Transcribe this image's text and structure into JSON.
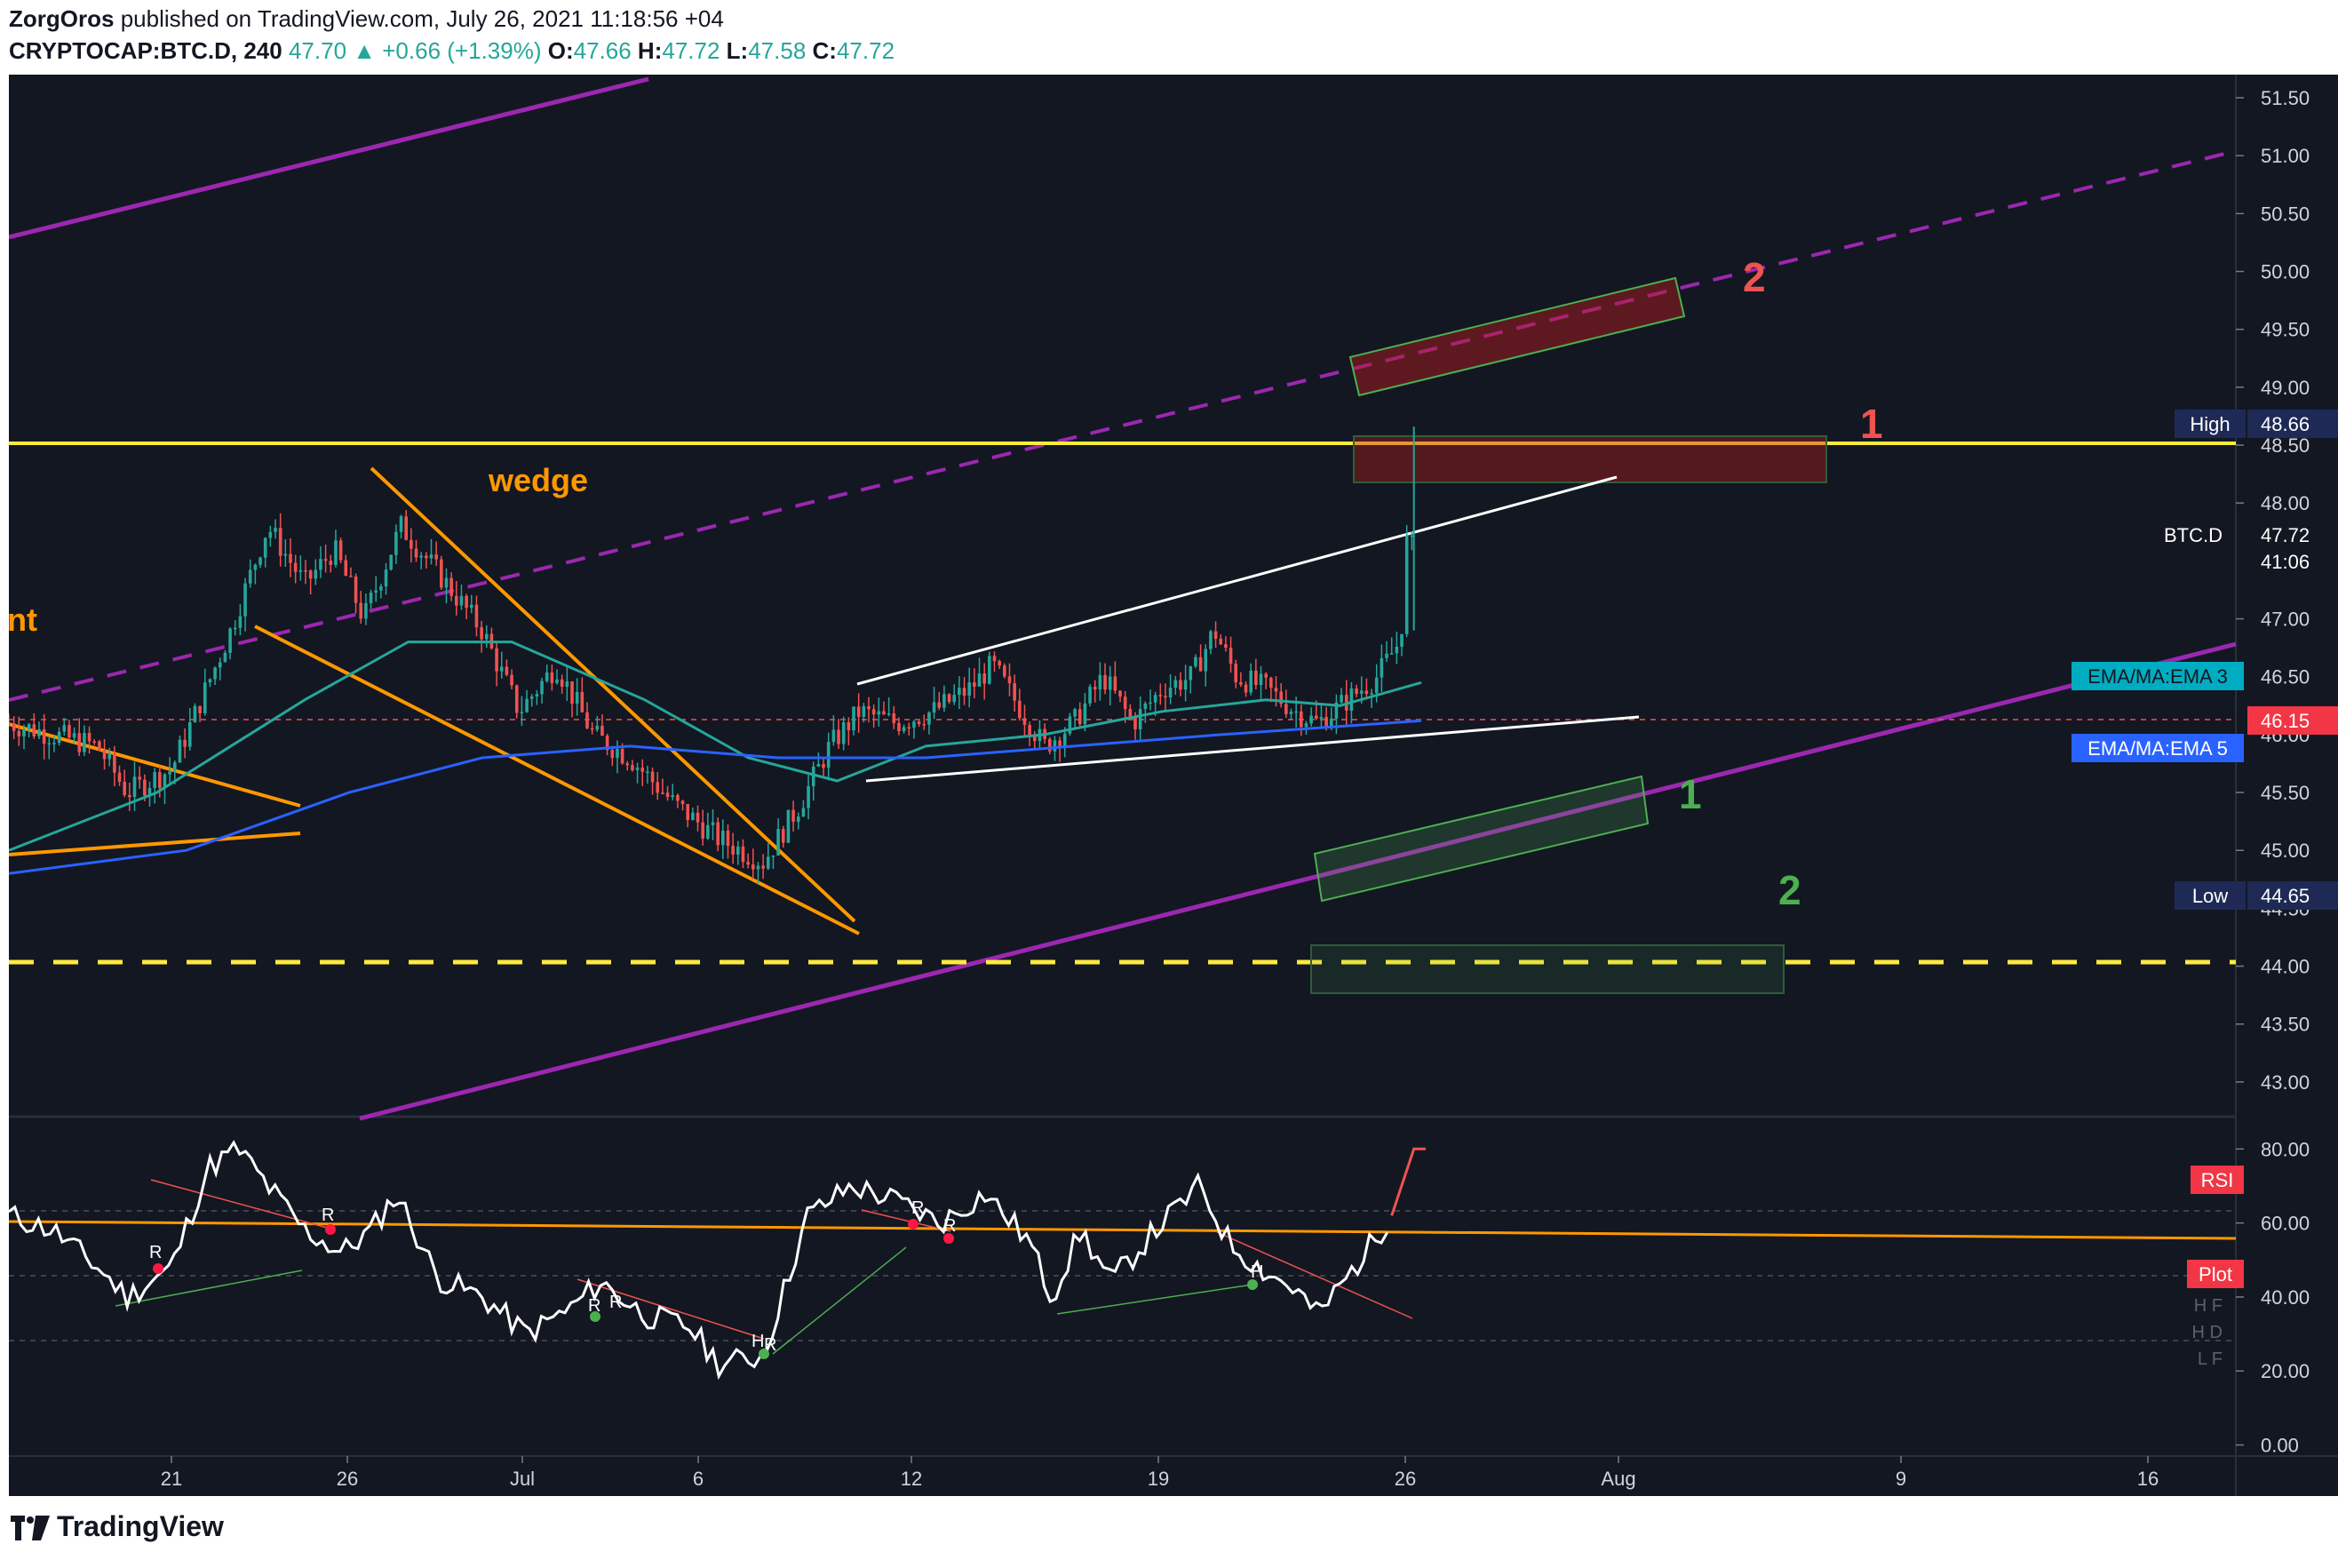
{
  "header": {
    "author": "ZorgOros",
    "published": "published on TradingView.com, July 26, 2021 11:18:56 +04",
    "symbol": "CRYPTOCAP:BTC.D, 240",
    "last": "47.70",
    "arrow": "▲",
    "change": "+0.66 (+1.39%)",
    "o_label": "O:",
    "o": "47.66",
    "h_label": "H:",
    "h": "47.72",
    "l_label": "L:",
    "l": "47.58",
    "c_label": "C:",
    "c": "47.72"
  },
  "annotations": {
    "wedge": "wedge",
    "edge_fragment": "nt",
    "red1": "1",
    "red2": "2",
    "green1": "1",
    "green2": "2"
  },
  "price_labels": {
    "high_title": "High",
    "high_value": "48.66",
    "btcd_title": "BTC.D",
    "btcd_value": "47.72",
    "btcd_countdown": "41:06",
    "ema3": "EMA/MA:EMA 3",
    "redline_value": "46.15",
    "ema5": "EMA/MA:EMA 5",
    "low_title": "Low",
    "low_value": "44.65",
    "rsi_title": "RSI",
    "plot_title": "Plot",
    "hf": "H F",
    "hd": "H D",
    "lf": "L F"
  },
  "footer": {
    "brand": "TradingView"
  },
  "colors": {
    "bg": "#131722",
    "up": "#26a69a",
    "down": "#ef5350",
    "yellow": "#ffeb3b",
    "purple": "#9c27b0",
    "orange": "#ff9800",
    "ema3": "#26a69a",
    "ema5": "#2962ff"
  },
  "chart_data": {
    "type": "candlestick",
    "title": "",
    "price_axis": {
      "ticks": [
        "51.50",
        "51.00",
        "50.50",
        "50.00",
        "49.50",
        "49.00",
        "48.50",
        "48.00",
        "47.00",
        "46.50",
        "46.00",
        "45.50",
        "45.00",
        "44.50",
        "44.00",
        "43.50",
        "43.00"
      ],
      "ylim": [
        42.7,
        51.7
      ]
    },
    "rsi_axis": {
      "ticks": [
        "80.00",
        "60.00",
        "40.00",
        "20.00",
        "0.00"
      ],
      "ylim": [
        -3,
        88
      ]
    },
    "time_axis": {
      "labels": [
        "21",
        "26",
        "Jul",
        "6",
        "12",
        "19",
        "26",
        "Aug",
        "9",
        "16"
      ]
    },
    "close_path": [
      {
        "t": 0,
        "v": 46.1
      },
      {
        "t": 30,
        "v": 46.0
      },
      {
        "t": 60,
        "v": 45.9
      },
      {
        "t": 80,
        "v": 45.5
      },
      {
        "t": 110,
        "v": 45.7
      },
      {
        "t": 150,
        "v": 46.9
      },
      {
        "t": 175,
        "v": 47.8
      },
      {
        "t": 200,
        "v": 47.3
      },
      {
        "t": 220,
        "v": 47.6
      },
      {
        "t": 240,
        "v": 47.0
      },
      {
        "t": 265,
        "v": 47.8
      },
      {
        "t": 290,
        "v": 47.4
      },
      {
        "t": 320,
        "v": 46.9
      },
      {
        "t": 345,
        "v": 46.2
      },
      {
        "t": 370,
        "v": 46.6
      },
      {
        "t": 395,
        "v": 46.0
      },
      {
        "t": 420,
        "v": 45.8
      },
      {
        "t": 450,
        "v": 45.4
      },
      {
        "t": 480,
        "v": 45.1
      },
      {
        "t": 510,
        "v": 44.9
      },
      {
        "t": 535,
        "v": 45.4
      },
      {
        "t": 555,
        "v": 45.9
      },
      {
        "t": 575,
        "v": 46.2
      },
      {
        "t": 600,
        "v": 46.1
      },
      {
        "t": 625,
        "v": 46.2
      },
      {
        "t": 650,
        "v": 46.4
      },
      {
        "t": 665,
        "v": 46.6
      },
      {
        "t": 680,
        "v": 46.3
      },
      {
        "t": 700,
        "v": 45.9
      },
      {
        "t": 720,
        "v": 46.1
      },
      {
        "t": 740,
        "v": 46.5
      },
      {
        "t": 760,
        "v": 46.1
      },
      {
        "t": 780,
        "v": 46.4
      },
      {
        "t": 800,
        "v": 46.5
      },
      {
        "t": 815,
        "v": 46.9
      },
      {
        "t": 830,
        "v": 46.5
      },
      {
        "t": 850,
        "v": 46.4
      },
      {
        "t": 870,
        "v": 46.2
      },
      {
        "t": 885,
        "v": 46.1
      },
      {
        "t": 905,
        "v": 46.3
      },
      {
        "t": 925,
        "v": 46.5
      },
      {
        "t": 940,
        "v": 46.8
      },
      {
        "t": 950,
        "v": 47.7
      }
    ],
    "ema3": [
      {
        "t": 0,
        "v": 45.0
      },
      {
        "t": 100,
        "v": 45.5
      },
      {
        "t": 200,
        "v": 46.3
      },
      {
        "t": 270,
        "v": 46.8
      },
      {
        "t": 340,
        "v": 46.8
      },
      {
        "t": 430,
        "v": 46.3
      },
      {
        "t": 500,
        "v": 45.8
      },
      {
        "t": 560,
        "v": 45.6
      },
      {
        "t": 620,
        "v": 45.9
      },
      {
        "t": 700,
        "v": 46.0
      },
      {
        "t": 780,
        "v": 46.2
      },
      {
        "t": 850,
        "v": 46.3
      },
      {
        "t": 900,
        "v": 46.25
      },
      {
        "t": 955,
        "v": 46.45
      }
    ],
    "ema5": [
      {
        "t": 0,
        "v": 44.8
      },
      {
        "t": 120,
        "v": 45.0
      },
      {
        "t": 230,
        "v": 45.5
      },
      {
        "t": 320,
        "v": 45.8
      },
      {
        "t": 420,
        "v": 45.9
      },
      {
        "t": 520,
        "v": 45.8
      },
      {
        "t": 620,
        "v": 45.8
      },
      {
        "t": 720,
        "v": 45.9
      },
      {
        "t": 820,
        "v": 46.0
      },
      {
        "t": 955,
        "v": 46.12
      }
    ],
    "rsi": [
      {
        "t": 0,
        "v": 62
      },
      {
        "t": 30,
        "v": 58
      },
      {
        "t": 60,
        "v": 48
      },
      {
        "t": 80,
        "v": 40
      },
      {
        "t": 110,
        "v": 48
      },
      {
        "t": 135,
        "v": 75
      },
      {
        "t": 155,
        "v": 80
      },
      {
        "t": 175,
        "v": 70
      },
      {
        "t": 200,
        "v": 58
      },
      {
        "t": 225,
        "v": 52
      },
      {
        "t": 245,
        "v": 58
      },
      {
        "t": 262,
        "v": 68
      },
      {
        "t": 290,
        "v": 45
      },
      {
        "t": 320,
        "v": 40
      },
      {
        "t": 350,
        "v": 30
      },
      {
        "t": 380,
        "v": 37
      },
      {
        "t": 400,
        "v": 44
      },
      {
        "t": 430,
        "v": 35
      },
      {
        "t": 460,
        "v": 32
      },
      {
        "t": 480,
        "v": 22
      },
      {
        "t": 510,
        "v": 24
      },
      {
        "t": 540,
        "v": 62
      },
      {
        "t": 570,
        "v": 70
      },
      {
        "t": 600,
        "v": 66
      },
      {
        "t": 630,
        "v": 60
      },
      {
        "t": 660,
        "v": 68
      },
      {
        "t": 690,
        "v": 55
      },
      {
        "t": 705,
        "v": 40
      },
      {
        "t": 725,
        "v": 58
      },
      {
        "t": 745,
        "v": 44
      },
      {
        "t": 775,
        "v": 58
      },
      {
        "t": 805,
        "v": 70
      },
      {
        "t": 825,
        "v": 55
      },
      {
        "t": 845,
        "v": 48
      },
      {
        "t": 870,
        "v": 42
      },
      {
        "t": 885,
        "v": 35
      },
      {
        "t": 910,
        "v": 48
      },
      {
        "t": 935,
        "v": 62
      },
      {
        "t": 950,
        "v": 80
      }
    ]
  }
}
